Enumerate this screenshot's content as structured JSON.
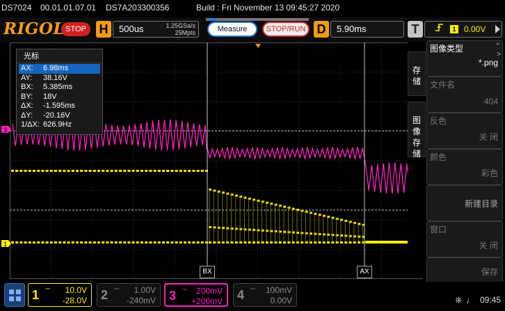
{
  "info_bar": {
    "model": "DS7024",
    "firmware": "00.01.01.07.01",
    "serial": "DS7A203300356",
    "build": "Build : Fri November 13 09:45:27 2020"
  },
  "header": {
    "logo": "RIGOL",
    "run_state": "STOP",
    "timebase_badge": "H",
    "timebase": "500us",
    "sample_rate": "1.25GSa/s",
    "mem_depth": "25Mpts",
    "measure_label": "Measure",
    "stoprun_label": "STOP/RUN",
    "delay_badge": "D",
    "delay": "5.90ms",
    "trigger_badge": "T",
    "trigger_slope_icon": "rising-edge-icon",
    "trigger_source": "1",
    "trigger_level": "0.00V"
  },
  "cursor_panel": {
    "title": "光标",
    "rows": [
      {
        "key": "AX:",
        "value": "6.98ms",
        "selected": true
      },
      {
        "key": "AY:",
        "value": "38.16V"
      },
      {
        "key": "BX:",
        "value": "5.385ms"
      },
      {
        "key": "BY:",
        "value": "18V"
      },
      {
        "key": "ΔX:",
        "value": "-1.595ms"
      },
      {
        "key": "ΔY:",
        "value": "-20.16V"
      },
      {
        "key": "1/ΔX:",
        "value": "626.9Hz"
      }
    ]
  },
  "cursor_markers": {
    "bx": "BX",
    "ax": "AX"
  },
  "side_tabs": [
    {
      "label": "存储"
    },
    {
      "label": "图像存储"
    }
  ],
  "side_menu": [
    {
      "label": "图像类型",
      "value": "*.png"
    },
    {
      "label": "文件名",
      "value": "404"
    },
    {
      "label": "反色",
      "value": "关 闭"
    },
    {
      "label": "颜色",
      "value": "彩色"
    },
    {
      "label": "",
      "value": "新建目录"
    },
    {
      "label": "窗口",
      "value": "关 闭"
    },
    {
      "label": "",
      "value": "保存"
    }
  ],
  "channels": [
    {
      "num": "1",
      "scale": "10.0V",
      "offset": "-28.0V",
      "color": "#ffee00",
      "active": true
    },
    {
      "num": "2",
      "scale": "1.00V",
      "offset": "-240mV",
      "color": "#00e5ff",
      "active": false
    },
    {
      "num": "3",
      "scale": "200mV",
      "offset": "+200mV",
      "color": "#ff1fbf",
      "active": true
    },
    {
      "num": "4",
      "scale": "100mV",
      "offset": "0.00V",
      "color": "#2a6cff",
      "active": false
    }
  ],
  "status": {
    "usb_icon": "usb-icon",
    "speaker_icon": "speaker-icon",
    "time": "09:45"
  },
  "colors": {
    "ch1": "#ffee00",
    "ch3": "#ff1fbf",
    "cursor": "#c8c8c8",
    "logo": "#f39c12",
    "stop": "#d0231f",
    "accent": "#2c7bd1"
  }
}
